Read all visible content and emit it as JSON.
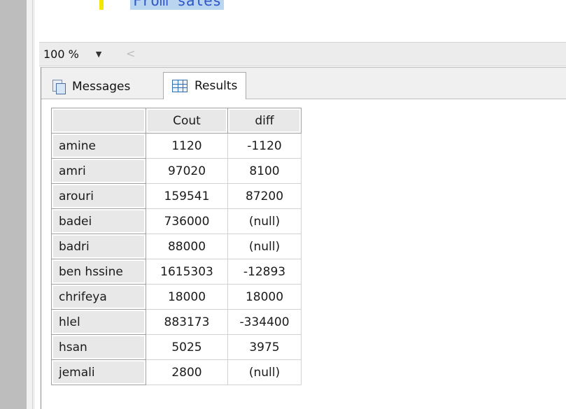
{
  "editor": {
    "code_line": "From sales"
  },
  "zoom": {
    "value": "100 %",
    "dropdown_icon": "chevron-down-icon",
    "scroll_icon": "chevron-left-icon"
  },
  "tabs": {
    "messages": {
      "label": "Messages",
      "icon": "messages-icon"
    },
    "results": {
      "label": "Results",
      "icon": "grid-icon"
    }
  },
  "grid": {
    "columns": [
      "Cout",
      "diff"
    ],
    "rows": [
      {
        "name": "amine",
        "cout": "1120",
        "diff": "-1120"
      },
      {
        "name": "amri",
        "cout": "97020",
        "diff": "8100"
      },
      {
        "name": "arouri",
        "cout": "159541",
        "diff": "87200"
      },
      {
        "name": "badei",
        "cout": "736000",
        "diff": "(null)"
      },
      {
        "name": "badri",
        "cout": "88000",
        "diff": "(null)"
      },
      {
        "name": "ben hssine",
        "cout": "1615303",
        "diff": "-12893"
      },
      {
        "name": "chrifeya",
        "cout": "18000",
        "diff": "18000"
      },
      {
        "name": "hlel",
        "cout": "883173",
        "diff": "-334400"
      },
      {
        "name": "hsan",
        "cout": "5025",
        "diff": "3975"
      },
      {
        "name": "jemali",
        "cout": "2800",
        "diff": "(null)"
      }
    ]
  },
  "colors": {
    "selection": "#b9d5ef",
    "keyword": "#2f57c9",
    "header_bg": "#e8e8e8"
  }
}
